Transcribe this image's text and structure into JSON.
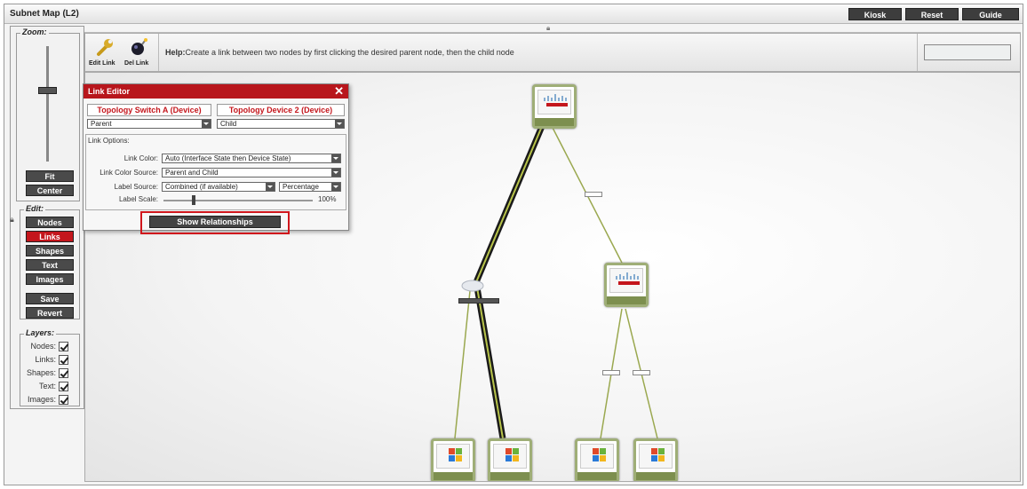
{
  "window": {
    "title": "Subnet Map (L2)",
    "buttons": [
      "Kiosk",
      "Reset",
      "Guide"
    ]
  },
  "sidebar": {
    "zoom_label": "Zoom:",
    "fit_label": "Fit",
    "center_label": "Center",
    "edit_label": "Edit:",
    "edit_buttons": [
      "Nodes",
      "Links",
      "Shapes",
      "Text",
      "Images"
    ],
    "active_edit": "Links",
    "save_label": "Save",
    "revert_label": "Revert",
    "layers_label": "Layers:",
    "layers": [
      "Nodes:",
      "Links:",
      "Shapes:",
      "Text:",
      "Images:"
    ]
  },
  "toolbar": {
    "edit_link_label": "Edit Link",
    "del_link_label": "Del Link",
    "help_prefix": "Help:",
    "help_text": "Create a link between two nodes by first clicking the desired parent node, then the child node"
  },
  "link_editor": {
    "title": "Link Editor",
    "device_a": "Topology Switch A (Device)",
    "device_b": "Topology Device 2 (Device)",
    "role_a": "Parent",
    "role_b": "Child",
    "options_label": "Link Options:",
    "link_color_label": "Link Color:",
    "link_color_value": "Auto (Interface State then Device State)",
    "color_source_label": "Link Color Source:",
    "color_source_value": "Parent and Child",
    "label_source_label": "Label Source:",
    "label_source_value": "Combined (if available)",
    "label_source_unit": "Percentage",
    "label_scale_label": "Label Scale:",
    "label_scale_value": "100%",
    "show_relationships_label": "Show Relationships"
  },
  "colors": {
    "accent_red": "#c4161c",
    "dark_button": "#3d3d3d",
    "link_green": "#9aa84f",
    "node_border": "#9fae77"
  }
}
